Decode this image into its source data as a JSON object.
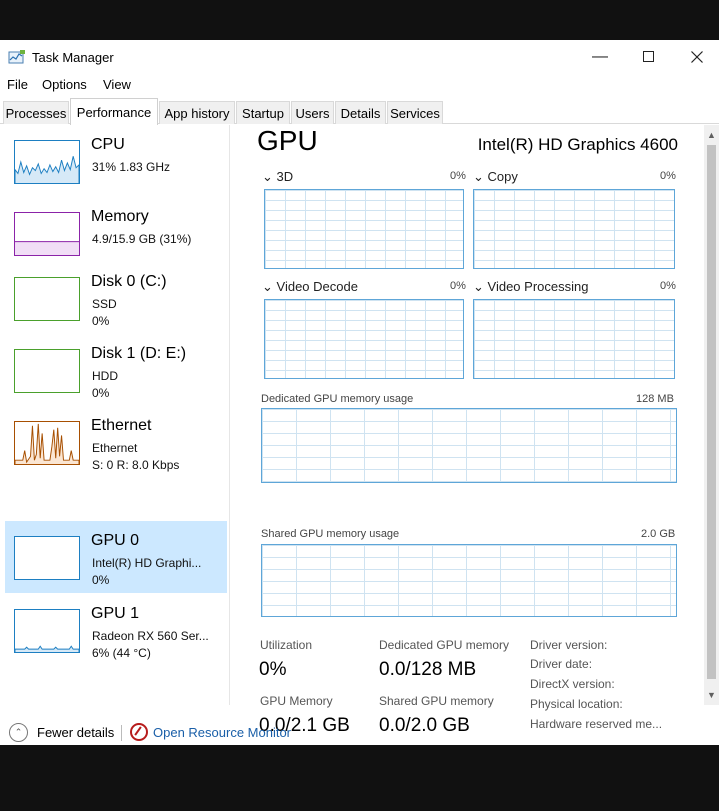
{
  "window": {
    "title": "Task Manager"
  },
  "menu": [
    "File",
    "Options",
    "View"
  ],
  "tabs": [
    {
      "label": "Processes"
    },
    {
      "label": "Performance",
      "active": true
    },
    {
      "label": "App history"
    },
    {
      "label": "Startup"
    },
    {
      "label": "Users"
    },
    {
      "label": "Details"
    },
    {
      "label": "Services"
    }
  ],
  "sidebar": {
    "items": [
      {
        "title": "CPU",
        "lines": [
          "31%  1.83 GHz"
        ],
        "color": "#1d7fc2"
      },
      {
        "title": "Memory",
        "lines": [
          "4.9/15.9 GB (31%)"
        ],
        "color": "#8b23a8"
      },
      {
        "title": "Disk 0 (C:)",
        "lines": [
          "SSD",
          "0%"
        ],
        "color": "#4aa02c"
      },
      {
        "title": "Disk 1 (D: E:)",
        "lines": [
          "HDD",
          "0%"
        ],
        "color": "#4aa02c"
      },
      {
        "title": "Ethernet",
        "lines": [
          "Ethernet",
          "S: 0 R: 8.0 Kbps"
        ],
        "color": "#a74f01"
      },
      {
        "title": "GPU 0",
        "lines": [
          "Intel(R) HD Graphi...",
          "0%"
        ],
        "color": "#1d7fc2",
        "selected": true
      },
      {
        "title": "GPU 1",
        "lines": [
          "Radeon RX 560 Ser...",
          "6% (44 °C)"
        ],
        "color": "#1d7fc2"
      }
    ]
  },
  "main": {
    "title": "GPU",
    "model": "Intel(R) HD Graphics 4600",
    "engines": [
      {
        "label": "3D",
        "pct": "0%"
      },
      {
        "label": "Copy",
        "pct": "0%"
      },
      {
        "label": "Video Decode",
        "pct": "0%"
      },
      {
        "label": "Video Processing",
        "pct": "0%"
      }
    ],
    "dedicated": {
      "label": "Dedicated GPU memory usage",
      "max": "128 MB"
    },
    "shared": {
      "label": "Shared GPU memory usage",
      "max": "2.0 GB"
    },
    "stats": {
      "utilization_label": "Utilization",
      "utilization_value": "0%",
      "dedicated_label": "Dedicated GPU memory",
      "dedicated_value": "0.0/128 MB",
      "gpu_memory_label": "GPU Memory",
      "gpu_memory_value": "0.0/2.1 GB",
      "shared_label": "Shared GPU memory",
      "shared_value": "0.0/2.0 GB"
    },
    "driver": [
      "Driver version:",
      "Driver date:",
      "DirectX version:",
      "Physical location:",
      "Hardware reserved me..."
    ]
  },
  "footer": {
    "fewer_details": "Fewer details",
    "open_monitor": "Open Resource Monitor"
  },
  "colors": {
    "graph_border": "#5ea6d8",
    "selection": "#cce8ff",
    "link": "#1a5fa8"
  }
}
